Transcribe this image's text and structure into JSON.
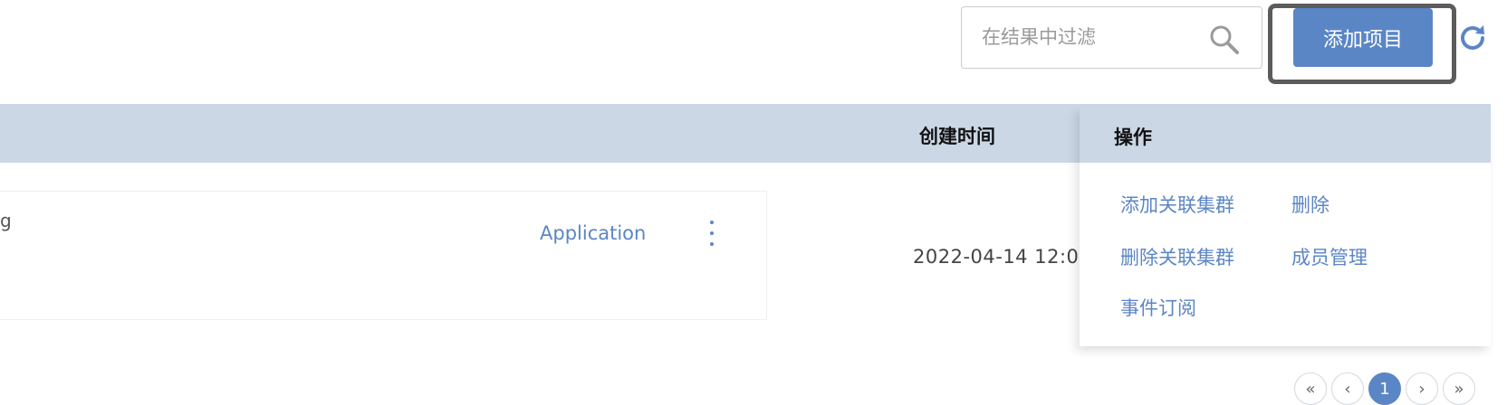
{
  "toolbar": {
    "search_placeholder": "在结果中过滤",
    "add_project_label": "添加项目"
  },
  "table": {
    "headers": {
      "created_time": "创建时间",
      "actions": "操作"
    },
    "rows": [
      {
        "name_fragment": "g",
        "type_link": "Application",
        "created_time": "2022-04-14 12:0"
      }
    ]
  },
  "action_menu": {
    "items": [
      "添加关联集群",
      "删除",
      "删除关联集群",
      "成员管理",
      "事件订阅"
    ]
  },
  "pagination": {
    "first": "«",
    "prev": "‹",
    "current": "1",
    "next": "›",
    "last": "»"
  },
  "colors": {
    "accent": "#5b86c6",
    "header_bg": "#cbd7e5"
  }
}
